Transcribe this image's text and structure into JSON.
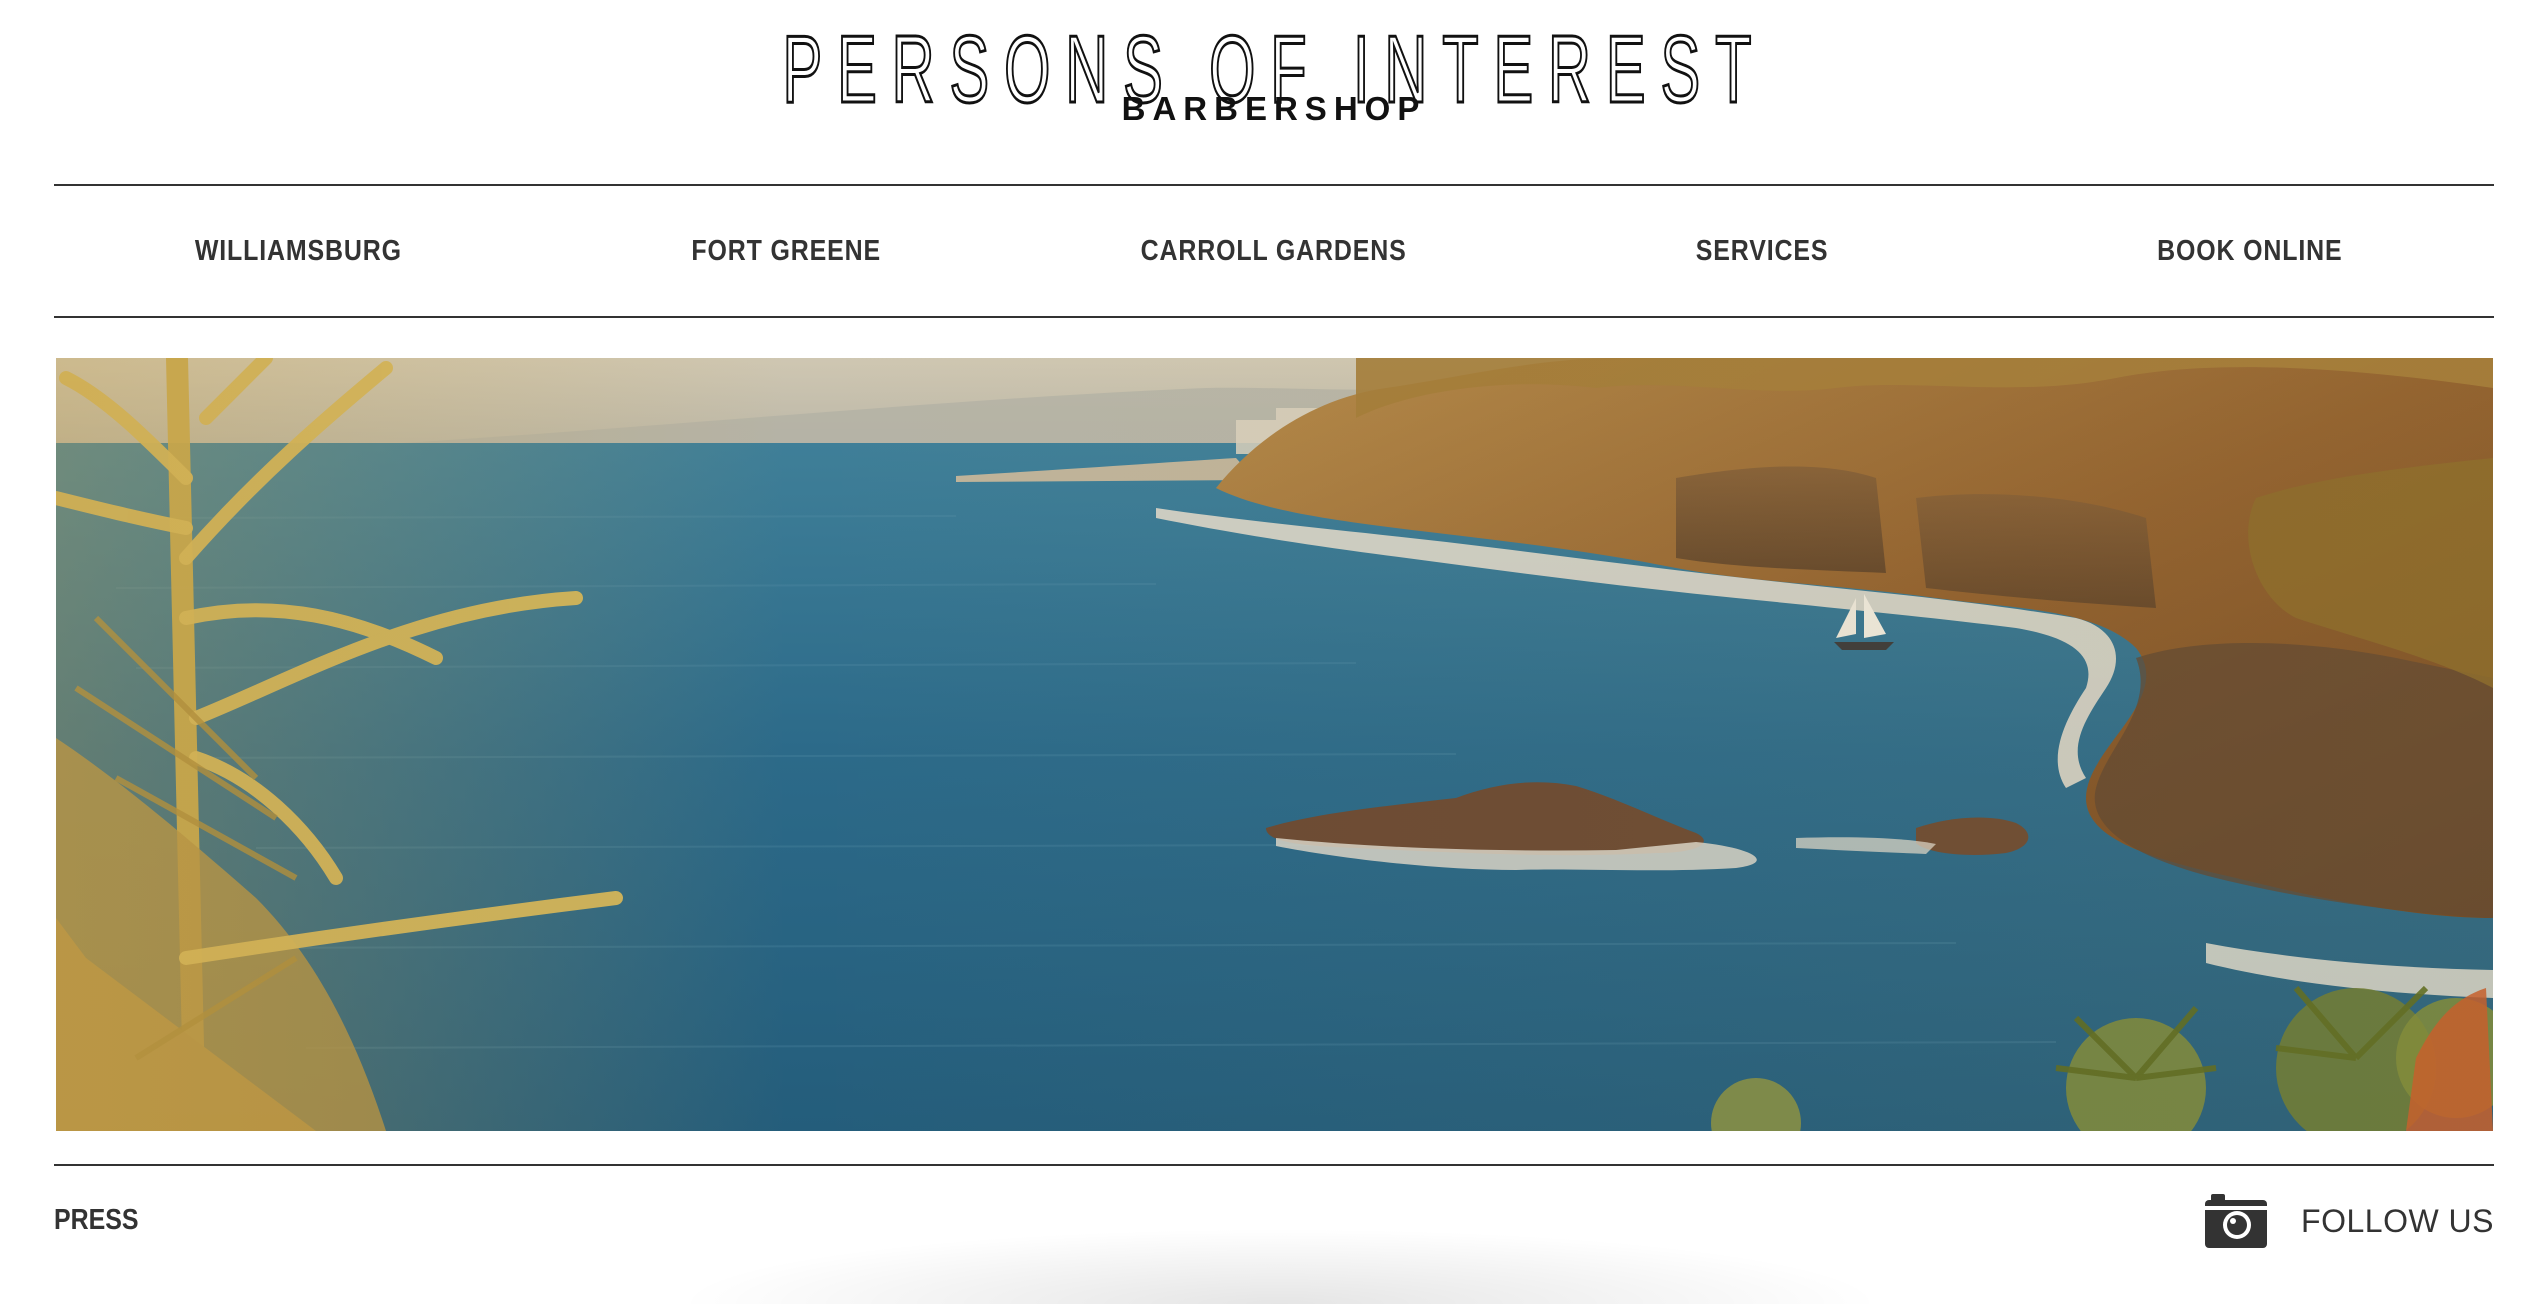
{
  "header": {
    "title": "PERSONS OF INTEREST",
    "subtitle": "BARBERSHOP"
  },
  "nav": {
    "items": [
      {
        "label": "WILLIAMSBURG"
      },
      {
        "label": "FORT GREENE"
      },
      {
        "label": "CARROLL GARDENS"
      },
      {
        "label": "SERVICES"
      },
      {
        "label": "BOOK ONLINE"
      }
    ]
  },
  "hero": {
    "icon": "coastal-landscape-photo"
  },
  "footer": {
    "press_label": "PRESS",
    "follow_label": "FOLLOW US",
    "follow_icon": "camera-icon"
  },
  "colors": {
    "text": "#333333",
    "background": "#ffffff",
    "sea": "#2d6e8e",
    "cliff": "#9a6a32"
  }
}
